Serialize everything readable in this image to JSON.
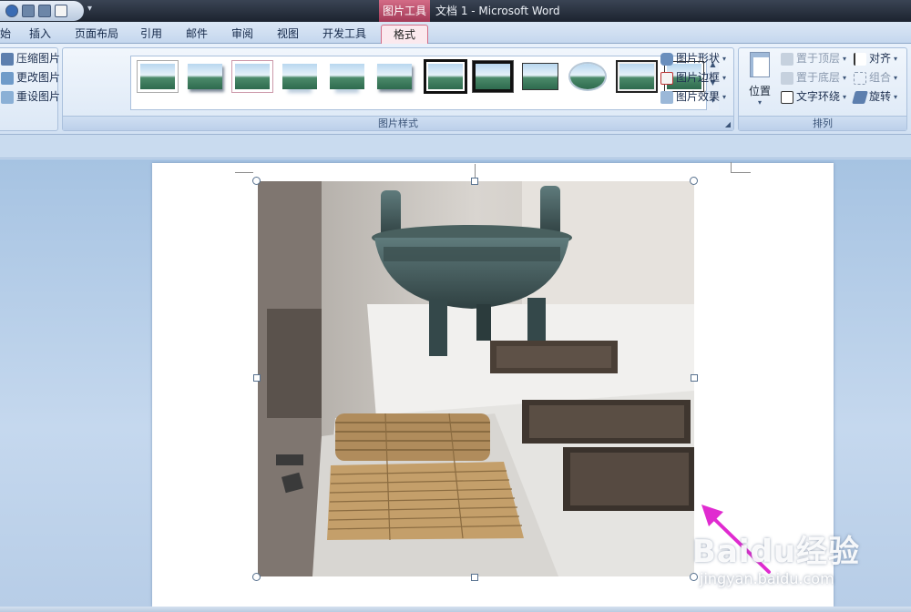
{
  "titlebar": {
    "context_tab": "图片工具",
    "doc_title": "文档 1 - Microsoft Word",
    "qat_more": "▾"
  },
  "tabs": [
    {
      "label": "始"
    },
    {
      "label": "插入"
    },
    {
      "label": "页面布局"
    },
    {
      "label": "引用"
    },
    {
      "label": "邮件"
    },
    {
      "label": "审阅"
    },
    {
      "label": "视图"
    },
    {
      "label": "开发工具"
    },
    {
      "label": "格式",
      "active": true
    }
  ],
  "adjust_group": {
    "compress": "压缩图片",
    "change": "更改图片",
    "reset": "重设图片"
  },
  "styles_group": {
    "label": "图片样式",
    "thumbnail_count": 12,
    "shape": "图片形状",
    "border": "图片边框",
    "effects": "图片效果"
  },
  "arrange_group": {
    "label": "排列",
    "position": "位置",
    "bring_front": "置于顶层",
    "send_back": "置于底层",
    "text_wrap": "文字环绕",
    "align": "对齐",
    "group": "组合",
    "rotate": "旋转"
  },
  "watermark": {
    "main": "Baidu经验",
    "sub": "jingyan.baidu.com"
  },
  "colors": {
    "context_tab": "#c1506e",
    "ribbon_bg": "#dce8f6",
    "annotation_arrow": "#e02bd0"
  }
}
